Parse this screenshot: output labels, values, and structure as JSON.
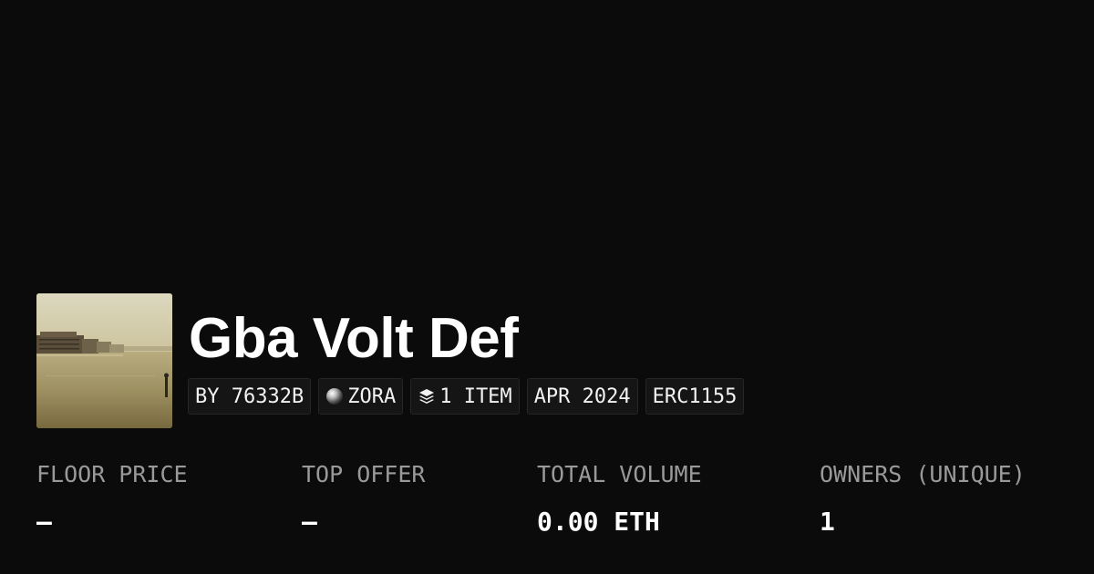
{
  "collection": {
    "title": "Gba Volt Def",
    "image": "harbor-waterfront-photo"
  },
  "tags": {
    "creator": "BY 76332B",
    "network": "ZORA",
    "network_icon": "zora-orb-icon",
    "items": "1 ITEM",
    "items_icon": "layers-icon",
    "date": "APR 2024",
    "standard": "ERC1155"
  },
  "stats": {
    "floor_price": {
      "label": "FLOOR PRICE",
      "value": "–"
    },
    "top_offer": {
      "label": "TOP OFFER",
      "value": "–"
    },
    "total_volume": {
      "label": "TOTAL VOLUME",
      "value": "0.00 ETH"
    },
    "owners": {
      "label": "OWNERS (UNIQUE)",
      "value": "1"
    }
  }
}
